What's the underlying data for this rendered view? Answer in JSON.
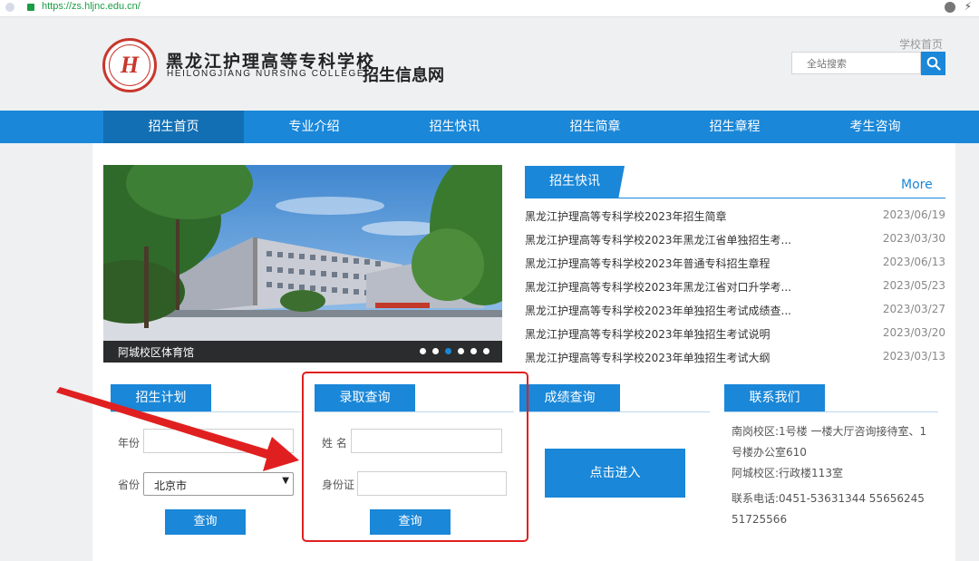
{
  "browser": {
    "url": "https://zs.hljnc.edu.cn/"
  },
  "header": {
    "logo_letter": "H",
    "school_cn": "黑龙江护理高等专科学校",
    "school_en": "HEILONGJIANG NURSING COLLEGE",
    "site_name": "招生信息网",
    "home_link": "学校首页",
    "search_placeholder": "全站搜索"
  },
  "nav": {
    "items": [
      "招生首页",
      "专业介绍",
      "招生快讯",
      "招生简章",
      "招生章程",
      "考生咨询"
    ],
    "active_index": 0
  },
  "banner": {
    "caption": "阿城校区体育馆",
    "dots_count": 6,
    "active_dot": 2
  },
  "news": {
    "tab": "招生快讯",
    "more": "More",
    "items": [
      {
        "title": "黑龙江护理高等专科学校2023年招生简章",
        "date": "2023/06/19"
      },
      {
        "title": "黑龙江护理高等专科学校2023年黑龙江省单独招生考...",
        "date": "2023/03/30"
      },
      {
        "title": "黑龙江护理高等专科学校2023年普通专科招生章程",
        "date": "2023/06/13"
      },
      {
        "title": "黑龙江护理高等专科学校2023年黑龙江省对口升学考...",
        "date": "2023/05/23"
      },
      {
        "title": "黑龙江护理高等专科学校2023年单独招生考试成绩查...",
        "date": "2023/03/27"
      },
      {
        "title": "黑龙江护理高等专科学校2023年单独招生考试说明",
        "date": "2023/03/20"
      },
      {
        "title": "黑龙江护理高等专科学校2023年单独招生考试大纲",
        "date": "2023/03/13"
      }
    ]
  },
  "plan": {
    "tab": "招生计划",
    "year_label": "年份",
    "province_label": "省份",
    "province_value": "北京市",
    "query": "查询"
  },
  "admission": {
    "tab": "录取查询",
    "name_label": "姓 名",
    "id_label": "身份证",
    "query": "查询"
  },
  "score": {
    "tab": "成绩查询",
    "enter": "点击进入"
  },
  "contact": {
    "tab": "联系我们",
    "lines": [
      "南岗校区:1号楼 一楼大厅咨询接待室、1",
      "号楼办公室610",
      "阿城校区:行政楼113室",
      "联系电话:0451-53631344   55656245",
      "51725566"
    ]
  },
  "colors": {
    "primary": "#1a87d8",
    "annotation": "#e02020"
  }
}
